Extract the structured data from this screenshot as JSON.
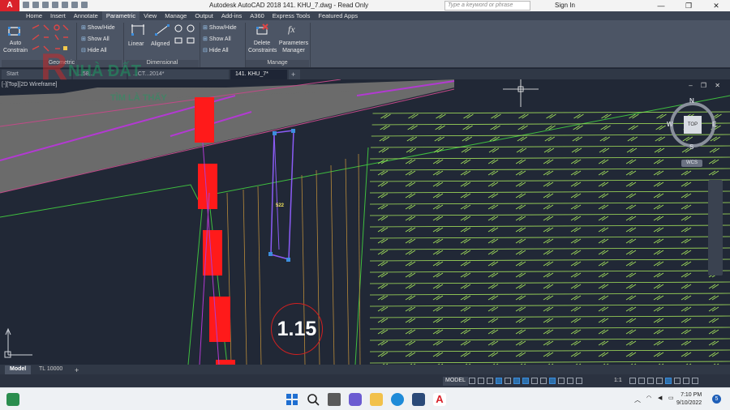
{
  "title_bar": {
    "app_icon": "A",
    "title": "Autodesk AutoCAD 2018    141. KHU_7.dwg - Read Only",
    "search_placeholder": "Type a keyword or phrase",
    "sign_in": "Sign In"
  },
  "ribbon_tabs": [
    "Home",
    "Insert",
    "Annotate",
    "Parametric",
    "View",
    "Manage",
    "Output",
    "Add-ins",
    "A360",
    "Express Tools",
    "Featured Apps"
  ],
  "active_ribbon_tab": "Parametric",
  "ribbon": {
    "auto_constrain": "Auto\nConstrain",
    "geometric_label": "Geometric",
    "show_hide_1": "Show/Hide",
    "show_all_1": "Show All",
    "hide_all_1": "Hide All",
    "linear": "Linear",
    "aligned": "Aligned",
    "dimensional_label": "Dimensional",
    "show_hide_2": "Show/Hide",
    "show_all_2": "Show All",
    "hide_all_2": "Hide All",
    "delete_constraints": "Delete\nConstraints",
    "parameters_manager": "Parameters\nManager",
    "manage_label": "Manage"
  },
  "file_tabs": [
    "Start",
    "...58...",
    "...CT...2014*",
    "141. KHU_7*"
  ],
  "active_file_tab": "141. KHU_7*",
  "viewport": {
    "label": "[-][Top][2D Wireframe]",
    "compass": {
      "n": "N",
      "s": "S",
      "e": "E",
      "w": "W",
      "top": "TOP",
      "wcs": "WCS"
    },
    "plot_label": "522",
    "parcel_label": "1.15"
  },
  "layout_tabs": [
    "Model",
    "TL 10000"
  ],
  "active_layout_tab": "Model",
  "status": {
    "model": "MODEL",
    "scale": "1:1"
  },
  "taskbar": {
    "time": "7:10 PM",
    "date": "9/10/2022",
    "notifications": "5"
  },
  "watermark": {
    "line1": "NHÀ ĐẤT",
    "line2": "TÌM LÀ THẤY"
  },
  "colors": {
    "accent": "#d9222a",
    "ribbon": "#4c5565",
    "canvas": "#212836",
    "hatch": "#a7e65c",
    "plot_outline": "#8b5cf6",
    "road_red": "#ff1a1a"
  }
}
